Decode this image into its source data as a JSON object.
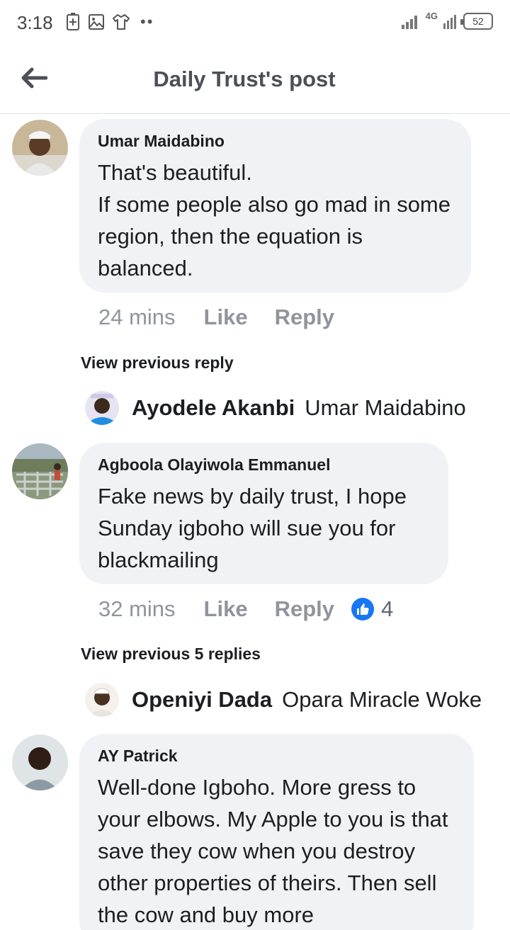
{
  "status_bar": {
    "time": "3:18",
    "dots": "••",
    "network": "4G",
    "battery": "52"
  },
  "header": {
    "title": "Daily Trust's post"
  },
  "comments": [
    {
      "author": "Umar Maidabino",
      "text": "That's beautiful.\nIf some people also go mad in some region, then the equation is balanced.",
      "time": "24 mins",
      "like_label": "Like",
      "reply_label": "Reply"
    },
    {
      "author": "Agboola Olayiwola Emmanuel",
      "text": "Fake news by daily trust, I hope Sunday igboho will sue you for blackmailing",
      "time": "32 mins",
      "like_label": "Like",
      "reply_label": "Reply",
      "like_count": "4"
    },
    {
      "author": "AY Patrick",
      "text": "Well-done Igboho. More gress to your elbows. My Apple to you is that save they cow when you destroy other properties of theirs. Then sell the cow and buy more"
    }
  ],
  "replies": [
    {
      "view_previous": "View previous reply",
      "author": "Ayodele Akanbi",
      "snippet": "Umar Maidabino"
    },
    {
      "view_previous": "View previous 5 replies",
      "author": "Openiyi Dada",
      "snippet": "Opara Miracle Woke"
    }
  ],
  "colors": {
    "bubble": "#f0f2f5",
    "meta_text": "#90949c",
    "like_blue": "#1877f2"
  }
}
